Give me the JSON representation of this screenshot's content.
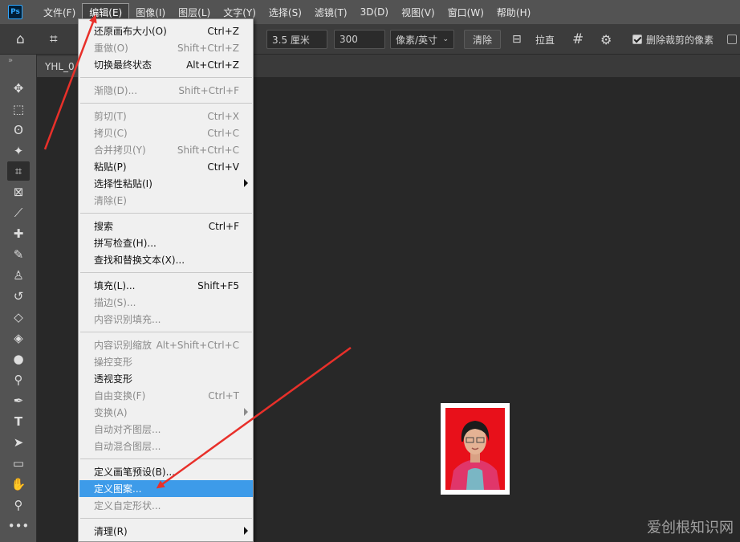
{
  "app": {
    "logo_text": "Ps"
  },
  "menubar": {
    "items": [
      {
        "label": "文件(F)"
      },
      {
        "label": "编辑(E)"
      },
      {
        "label": "图像(I)"
      },
      {
        "label": "图层(L)"
      },
      {
        "label": "文字(Y)"
      },
      {
        "label": "选择(S)"
      },
      {
        "label": "滤镜(T)"
      },
      {
        "label": "3D(D)"
      },
      {
        "label": "视图(V)"
      },
      {
        "label": "窗口(W)"
      },
      {
        "label": "帮助(H)"
      }
    ]
  },
  "options": {
    "width_value": "3.5 厘米",
    "resolution_value": "300",
    "unit_select": "像素/英寸",
    "clear_label": "清除",
    "straighten_label": "拉直",
    "delete_cropped_label": "删除裁剪的像素"
  },
  "document": {
    "tab_title": "YHL_0"
  },
  "edit_menu": {
    "items": [
      {
        "label": "还原画布大小(O)",
        "shortcut": "Ctrl+Z",
        "enabled": true
      },
      {
        "label": "重做(O)",
        "shortcut": "Shift+Ctrl+Z",
        "enabled": false
      },
      {
        "label": "切换最终状态",
        "shortcut": "Alt+Ctrl+Z",
        "enabled": true
      },
      {
        "label": "渐隐(D)...",
        "shortcut": "Shift+Ctrl+F",
        "enabled": false
      },
      {
        "label": "剪切(T)",
        "shortcut": "Ctrl+X",
        "enabled": false
      },
      {
        "label": "拷贝(C)",
        "shortcut": "Ctrl+C",
        "enabled": false
      },
      {
        "label": "合并拷贝(Y)",
        "shortcut": "Shift+Ctrl+C",
        "enabled": false
      },
      {
        "label": "粘贴(P)",
        "shortcut": "Ctrl+V",
        "enabled": true
      },
      {
        "label": "选择性粘贴(I)",
        "shortcut": "",
        "enabled": true,
        "submenu": true
      },
      {
        "label": "清除(E)",
        "shortcut": "",
        "enabled": false
      },
      {
        "label": "搜索",
        "shortcut": "Ctrl+F",
        "enabled": true
      },
      {
        "label": "拼写检查(H)...",
        "shortcut": "",
        "enabled": true
      },
      {
        "label": "查找和替换文本(X)...",
        "shortcut": "",
        "enabled": true
      },
      {
        "label": "填充(L)...",
        "shortcut": "Shift+F5",
        "enabled": true
      },
      {
        "label": "描边(S)...",
        "shortcut": "",
        "enabled": false
      },
      {
        "label": "内容识别填充...",
        "shortcut": "",
        "enabled": false
      },
      {
        "label": "内容识别缩放",
        "shortcut": "Alt+Shift+Ctrl+C",
        "enabled": false
      },
      {
        "label": "操控变形",
        "shortcut": "",
        "enabled": false
      },
      {
        "label": "透视变形",
        "shortcut": "",
        "enabled": true
      },
      {
        "label": "自由变换(F)",
        "shortcut": "Ctrl+T",
        "enabled": false
      },
      {
        "label": "变换(A)",
        "shortcut": "",
        "enabled": false,
        "submenu": true
      },
      {
        "label": "自动对齐图层...",
        "shortcut": "",
        "enabled": false
      },
      {
        "label": "自动混合图层...",
        "shortcut": "",
        "enabled": false
      },
      {
        "label": "定义画笔预设(B)...",
        "shortcut": "",
        "enabled": true
      },
      {
        "label": "定义图案...",
        "shortcut": "",
        "enabled": true,
        "highlighted": true
      },
      {
        "label": "定义自定形状...",
        "shortcut": "",
        "enabled": false
      },
      {
        "label": "清理(R)",
        "shortcut": "",
        "enabled": true,
        "submenu": true
      }
    ]
  },
  "watermark": "爱创根知识网",
  "colors": {
    "highlight": "#3d9be9",
    "arrow": "#e8302a",
    "photo_bg": "#e8101a"
  }
}
